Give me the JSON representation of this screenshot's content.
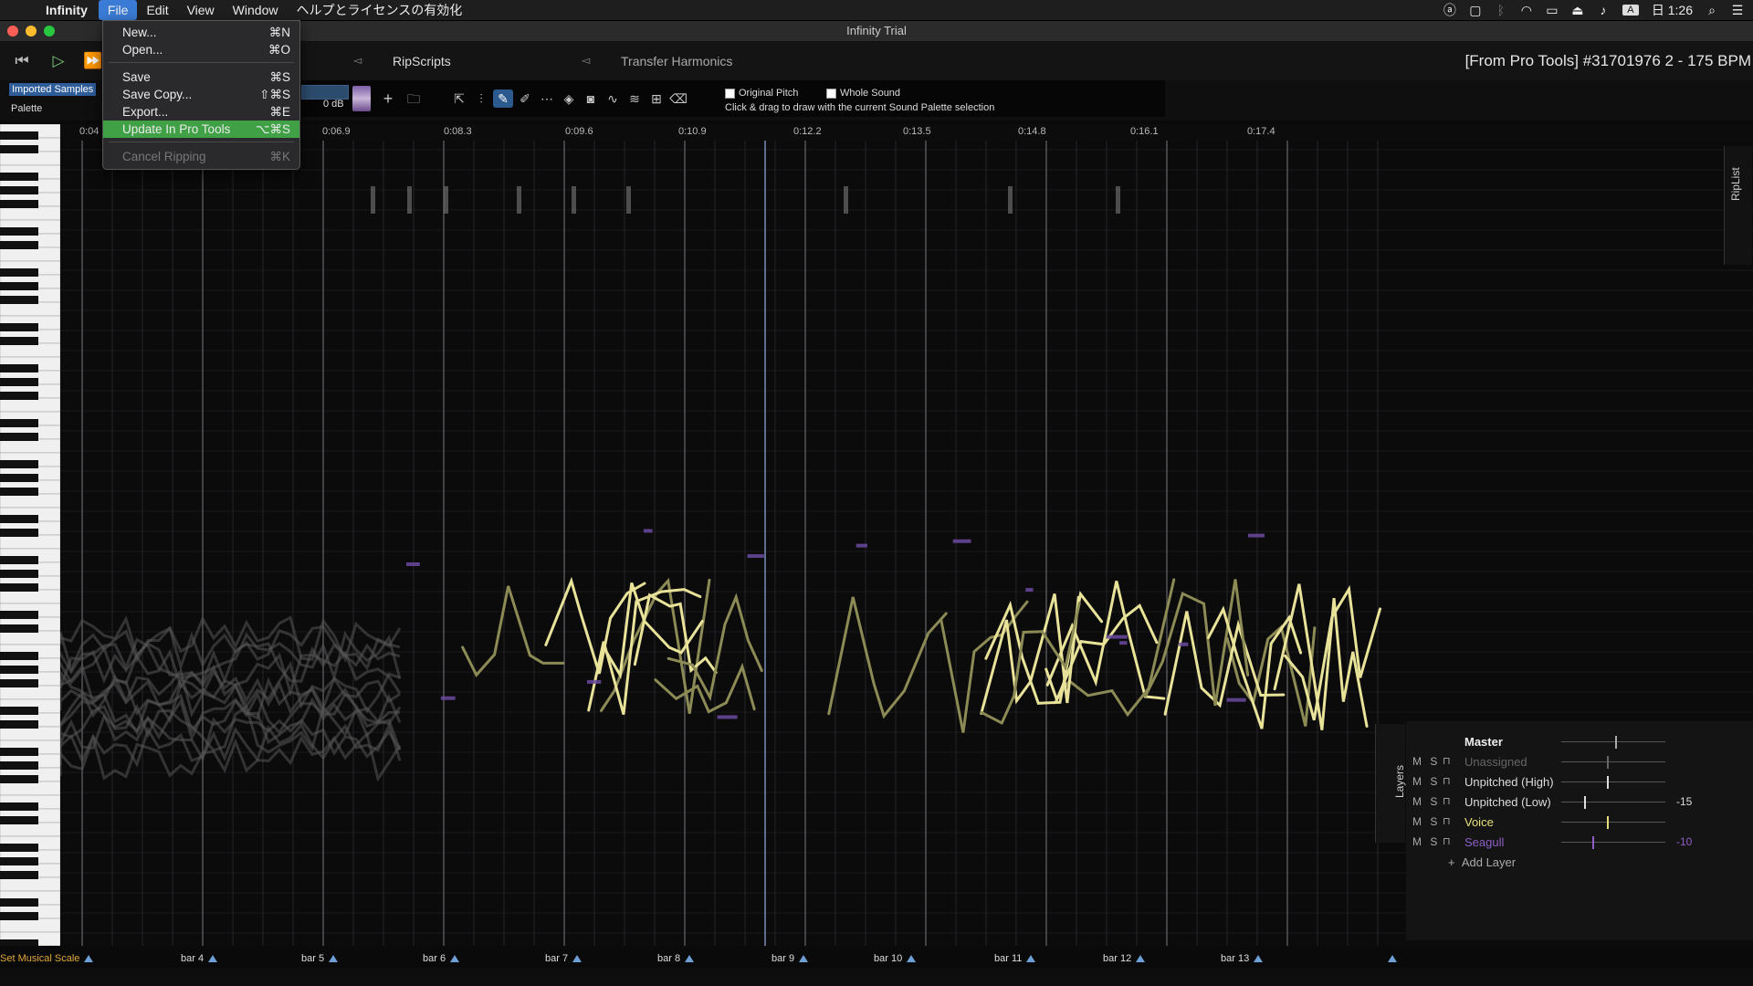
{
  "menubar": {
    "app_name": "Infinity",
    "items": [
      "File",
      "Edit",
      "View",
      "Window",
      "ヘルプとライセンスの有効化"
    ],
    "clock": "日 1:26",
    "input_indicator": "A"
  },
  "window": {
    "title": "Infinity Trial"
  },
  "file_menu": {
    "items": [
      {
        "label": "New...",
        "shortcut": "⌘N"
      },
      {
        "label": "Open...",
        "shortcut": "⌘O"
      },
      {
        "label": "Save",
        "shortcut": "⌘S"
      },
      {
        "label": "Save Copy...",
        "shortcut": "⇧⌘S"
      },
      {
        "label": "Export...",
        "shortcut": "⌘E"
      },
      {
        "label": "Update In Pro Tools",
        "shortcut": "⌥⌘S"
      },
      {
        "label": "Cancel Ripping",
        "shortcut": "⌘K"
      }
    ]
  },
  "transport": {
    "tabs": [
      "RipScripts",
      "Transfer Harmonics"
    ],
    "track_title": "[From Pro Tools] #31701976 2 - 175 BPM"
  },
  "toolbar": {
    "imported_label": "Imported Samples",
    "palette_label": "Palette",
    "gain_label": "0 dB",
    "original_pitch_label": "Original Pitch",
    "whole_sound_label": "Whole Sound",
    "hint": "Click & drag to draw with the current Sound Palette selection",
    "tool_icons": [
      "pointer-icon",
      "waveform-select-icon",
      "draw-pencil-icon",
      "brush-icon",
      "line-icon",
      "fill-bucket-icon",
      "camera-icon",
      "curve-icon",
      "wave-icon",
      "stamp-icon",
      "eraser-icon"
    ]
  },
  "ruler": {
    "ticks": [
      "0:04",
      "0:06.9",
      "0:08.3",
      "0:09.6",
      "0:10.9",
      "0:12.2",
      "0:13.5",
      "0:14.8",
      "0:16.1",
      "0:17.4"
    ]
  },
  "riplist_label": "RipList",
  "layers": {
    "tab_label": "Layers",
    "master_label": "Master",
    "add_label": "Add Layer",
    "ms_label": "M S",
    "rows": [
      {
        "name": "Unassigned",
        "color": "#666666",
        "value": "",
        "knob": 0.44
      },
      {
        "name": "Unpitched (High)",
        "color": "#dddddd",
        "value": "",
        "knob": 0.44
      },
      {
        "name": "Unpitched (Low)",
        "color": "#dddddd",
        "value": "-15",
        "knob": 0.22
      },
      {
        "name": "Voice",
        "color": "#e6e07a",
        "value": "",
        "knob": 0.44
      },
      {
        "name": "Seagull",
        "color": "#8d5fc6",
        "value": "-10",
        "knob": 0.3
      }
    ]
  },
  "bars": {
    "scale_label": "Set Musical Scale",
    "labels": [
      "bar 4",
      "bar 5",
      "bar 6",
      "bar 7",
      "bar 8",
      "bar 9",
      "bar 10",
      "bar 11",
      "bar 12",
      "bar 13"
    ]
  }
}
